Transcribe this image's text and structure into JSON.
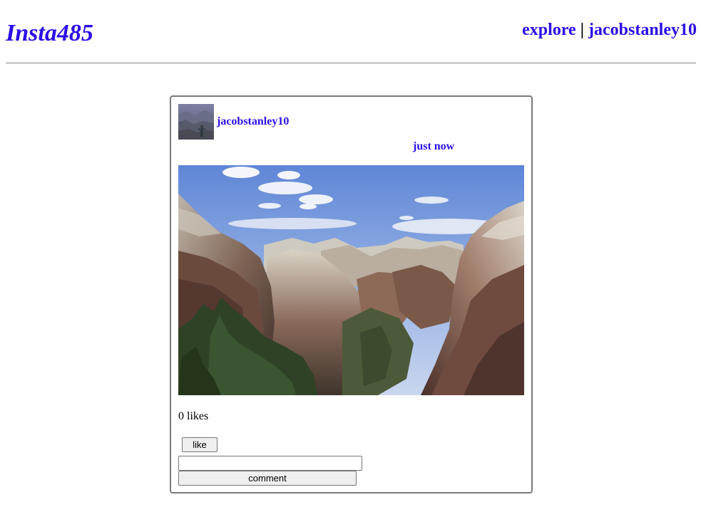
{
  "header": {
    "logo": "Insta485",
    "nav": {
      "explore_label": "explore",
      "separator": "|",
      "user_label": "jacobstanley10"
    }
  },
  "post": {
    "owner": "jacobstanley10",
    "timestamp": "just now",
    "likes_text": "0 likes",
    "like_button_label": "like",
    "comment_input_value": "",
    "comment_button_label": "comment"
  },
  "colors": {
    "link": "#2a0fe6",
    "card_border": "#7a7a7a",
    "rule": "#888888"
  }
}
